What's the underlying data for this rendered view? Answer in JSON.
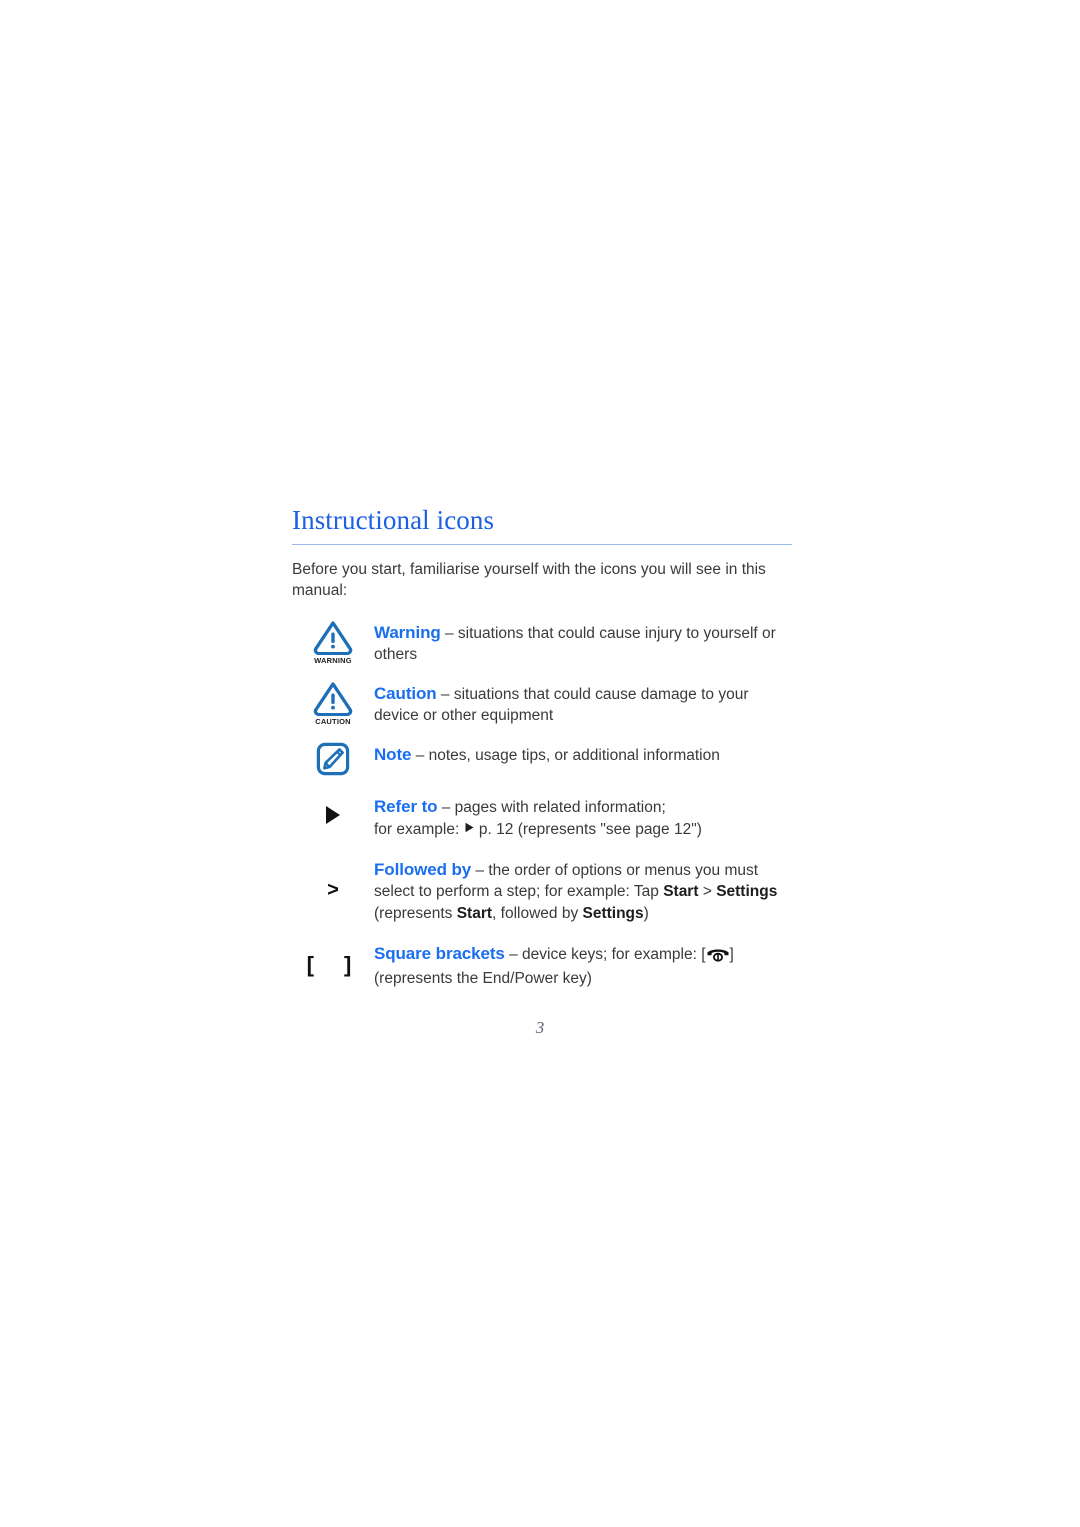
{
  "document": {
    "section_title": "Instructional icons",
    "intro": "Before you start, familiarise yourself with the icons you will see in this manual:",
    "page_number": "3"
  },
  "colors": {
    "heading_blue": "#1c60e3",
    "keyword_blue": "#1a6ff0",
    "rule_blue": "#9cb9ef",
    "icon_blue": "#1d6fb8",
    "body_text": "#3a3a3a",
    "page_number": "#5a6472"
  },
  "rows": [
    {
      "id": "warning",
      "icon": "warning-triangle-icon",
      "icon_label": "WARNING",
      "keyword": "Warning",
      "dash": " – ",
      "description": "situations that could cause injury to yourself or others"
    },
    {
      "id": "caution",
      "icon": "caution-triangle-icon",
      "icon_label": "CAUTION",
      "keyword": "Caution",
      "dash": " – ",
      "description": "situations that could cause damage to your device or other equipment"
    },
    {
      "id": "note",
      "icon": "note-pencil-icon",
      "icon_label": "",
      "keyword": "Note",
      "dash": " – ",
      "description": "notes, usage tips, or additional information"
    },
    {
      "id": "refer-to",
      "icon": "play-triangle-icon",
      "icon_label": "",
      "keyword": "Refer to",
      "dash": " – ",
      "description": "pages with related information;",
      "line2_before": "for example: ",
      "line2_after": " p. 12 (represents \"see page 12\")"
    },
    {
      "id": "followed-by",
      "icon": "greater-than-icon",
      "icon_label": ">",
      "keyword": "Followed by",
      "dash": " – ",
      "description": "the order of options or menus you must",
      "line2_before": "select to perform a step; for example: Tap ",
      "line2_bold_a": "Start",
      "line2_mid": " > ",
      "line2_bold_b": "Settings",
      "line3_before": "(represents ",
      "line3_bold_a": "Start",
      "line3_mid": ", followed by ",
      "line3_bold_b": "Settings",
      "line3_after": ")"
    },
    {
      "id": "square-brackets",
      "icon": "square-brackets-icon",
      "icon_label": "[    ]",
      "keyword": "Square brackets",
      "dash": " – ",
      "description": "device keys; for example: [",
      "description_tail": "]",
      "inline_key_icon": "end-power-key-icon",
      "line2": "(represents the End/Power key)"
    }
  ]
}
